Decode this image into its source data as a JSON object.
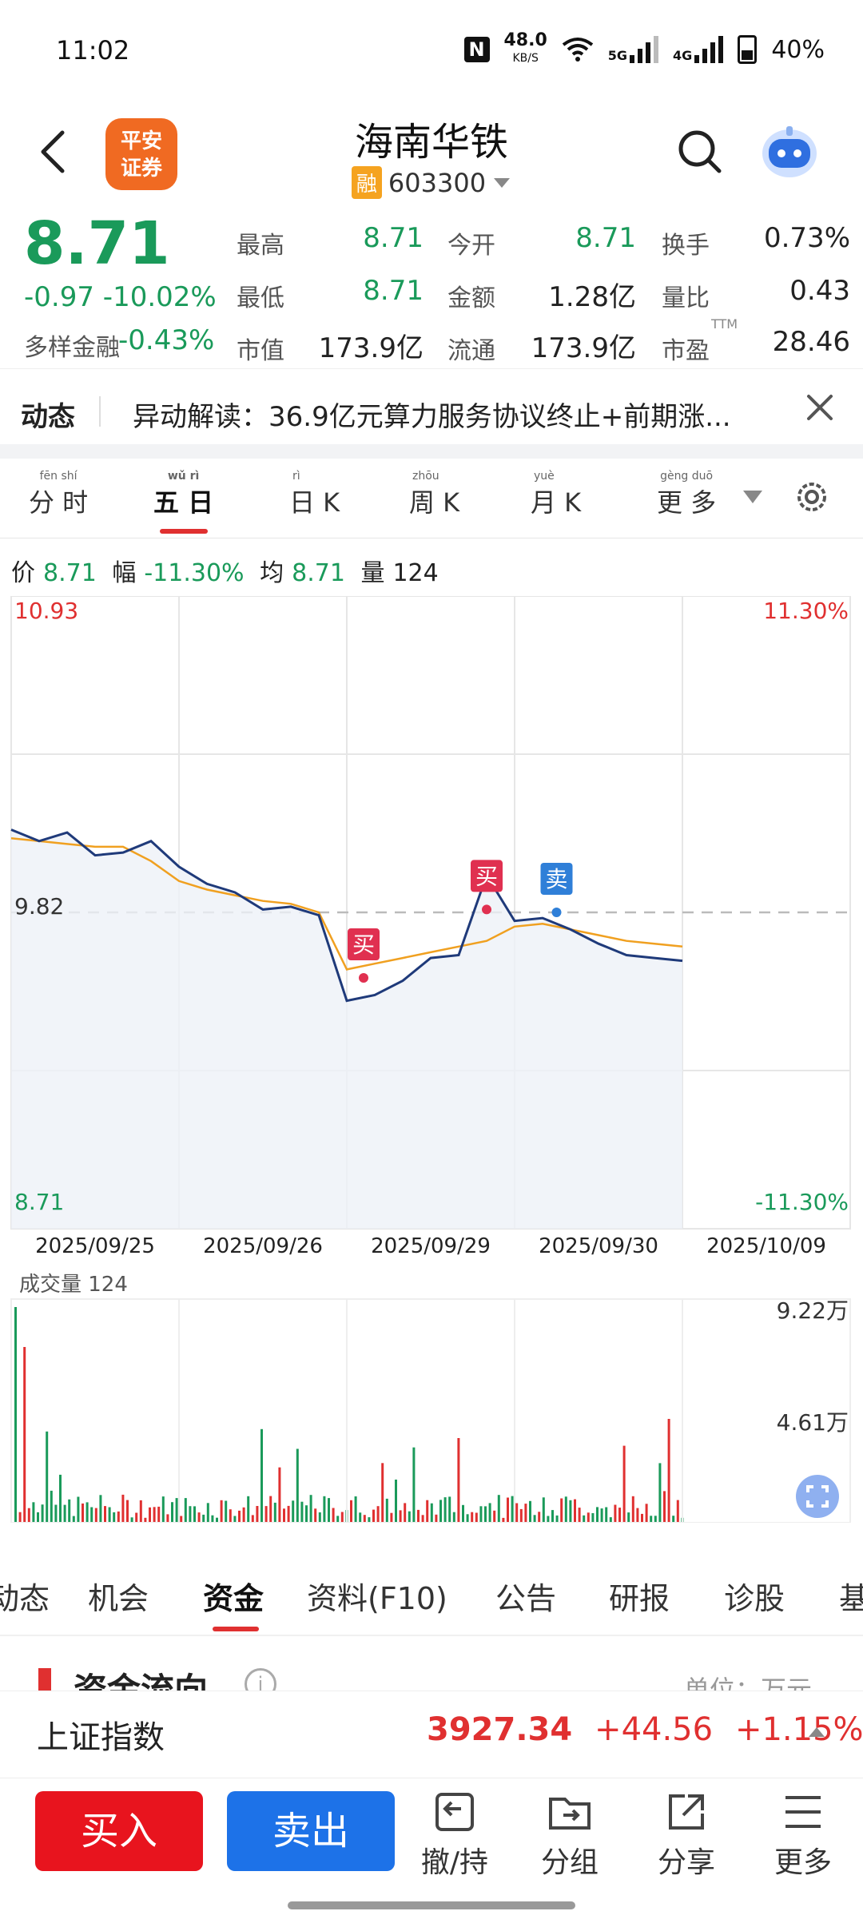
{
  "status_bar": {
    "time": "11:02",
    "net_speed": "48.0",
    "net_unit": "KB/S",
    "sim1": "5G",
    "sim2": "4G",
    "battery": "40%"
  },
  "header": {
    "logo_line1": "平安",
    "logo_line2": "证券",
    "title": "海南华铁",
    "margin_tag": "融",
    "code": "603300"
  },
  "quote": {
    "price": "8.71",
    "change": "-0.97",
    "change_pct": "-10.02%",
    "sector_label": "多样金融",
    "sector_pct": "-0.43%",
    "fields": [
      {
        "label": "最高",
        "value": "8.71"
      },
      {
        "label": "今开",
        "value": "8.71"
      },
      {
        "label": "换手",
        "value": "0.73%"
      },
      {
        "label": "最低",
        "value": "8.71"
      },
      {
        "label": "金额",
        "value": "1.28亿"
      },
      {
        "label": "量比",
        "value": "0.43"
      },
      {
        "label": "市值",
        "value": "173.9亿"
      },
      {
        "label": "流通",
        "value": "173.9亿"
      },
      {
        "label": "市盈",
        "value": "28.46"
      }
    ],
    "ttm": "TTM"
  },
  "news": {
    "tag": "动态",
    "text": "异动解读：36.9亿元算力服务协议终止+前期涨..."
  },
  "period_tabs": [
    {
      "label": "分 时",
      "pinyin": "fēn  shí"
    },
    {
      "label": "五 日",
      "pinyin": "wǔ  rì"
    },
    {
      "label": "日 K",
      "pinyin": "rì"
    },
    {
      "label": "周 K",
      "pinyin": "zhōu"
    },
    {
      "label": "月 K",
      "pinyin": "yuè"
    },
    {
      "label": "更 多",
      "pinyin": "gèng  duō"
    }
  ],
  "price_line": {
    "p_label": "价",
    "p": "8.71",
    "f_label": "幅",
    "f": "-11.30%",
    "a_label": "均",
    "a": "8.71",
    "v_label": "量",
    "v": "124"
  },
  "chart_data": {
    "type": "line",
    "title": "",
    "x": [
      "2025/09/25",
      "2025/09/26",
      "2025/09/29",
      "2025/09/30",
      "2025/10/09"
    ],
    "y_max_label": "10.93",
    "y_mid_label": "9.82",
    "y_min_label": "8.71",
    "pct_max_label": "11.30%",
    "pct_min_label": "-11.30%",
    "ylim": [
      8.71,
      10.93
    ],
    "series": [
      {
        "values": [
          10.11,
          10.07,
          10.1,
          10.02,
          10.03,
          10.07,
          9.98,
          9.92,
          9.89,
          9.83,
          9.84,
          9.81,
          9.51,
          9.53,
          9.58,
          9.66,
          9.67,
          9.95,
          9.79,
          9.8,
          9.76,
          9.71,
          9.67,
          9.66,
          9.65
        ]
      },
      {
        "values": [
          10.08,
          10.07,
          10.06,
          10.05,
          10.05,
          10.0,
          9.93,
          9.9,
          9.88,
          9.86,
          9.85,
          9.82,
          9.62,
          9.64,
          9.66,
          9.68,
          9.7,
          9.72,
          9.77,
          9.78,
          9.76,
          9.74,
          9.72,
          9.71,
          9.7
        ]
      }
    ],
    "markers": [
      {
        "label": "买",
        "kind": "buy",
        "x": 12.6,
        "y": 9.59
      },
      {
        "label": "买",
        "kind": "buy",
        "x": 17.0,
        "y": 9.83
      },
      {
        "label": "卖",
        "kind": "sell",
        "x": 19.5,
        "y": 9.82
      }
    ],
    "volume": {
      "label": "成交量",
      "value": "124",
      "max_label": "9.22万",
      "mid_label": "4.61万"
    }
  },
  "content_tabs": [
    "动态",
    "机会",
    "资金",
    "资料(F10)",
    "公告",
    "研报",
    "诊股",
    "基"
  ],
  "fund": {
    "title": "资金流向",
    "unit": "单位：万元"
  },
  "index_bar": {
    "name": "上证指数",
    "value": "3927.34",
    "change": "+44.56",
    "pct": "+1.15%"
  },
  "actions": {
    "buy": "买入",
    "sell": "卖出",
    "hold": "撤/持",
    "group": "分组",
    "share": "分享",
    "more": "更多"
  },
  "colors": {
    "up": "#e03030",
    "down": "#1a9a5a",
    "price_line": "#1f3a7a",
    "avg_line": "#f0a020",
    "buy_btn": "#e8141e",
    "sell_btn": "#1d72e8"
  }
}
